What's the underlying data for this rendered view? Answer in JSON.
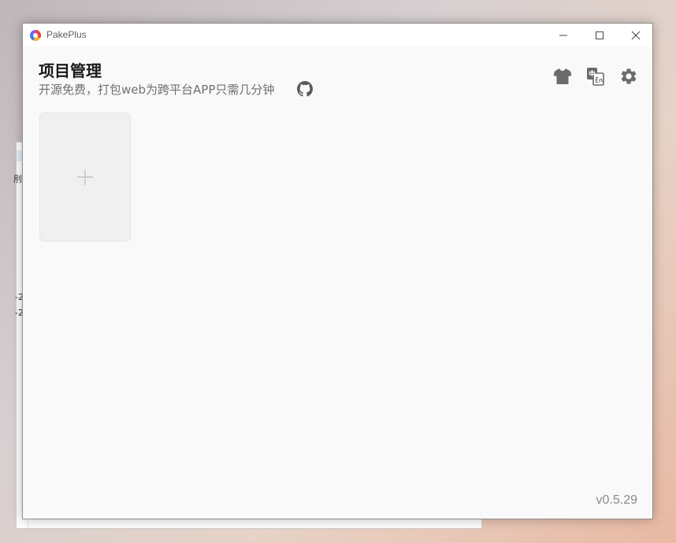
{
  "window": {
    "title": "PakePlus"
  },
  "header": {
    "title": "项目管理",
    "subtitle": "开源免费，打包web为跨平台APP只需几分钟"
  },
  "toolbar": {
    "icons": [
      "tshirt-icon",
      "translate-icon",
      "gear-icon"
    ]
  },
  "projects": {
    "add_card_icon": "plus-icon"
  },
  "footer": {
    "version": "v0.5.29"
  },
  "background_window": {
    "glyphs": [
      "刖",
      "-2",
      "-2"
    ]
  },
  "colors": {
    "icon_gray": "#6b6b6b",
    "card_bg": "#f0f0f0",
    "window_bg": "#f9f9f9"
  }
}
